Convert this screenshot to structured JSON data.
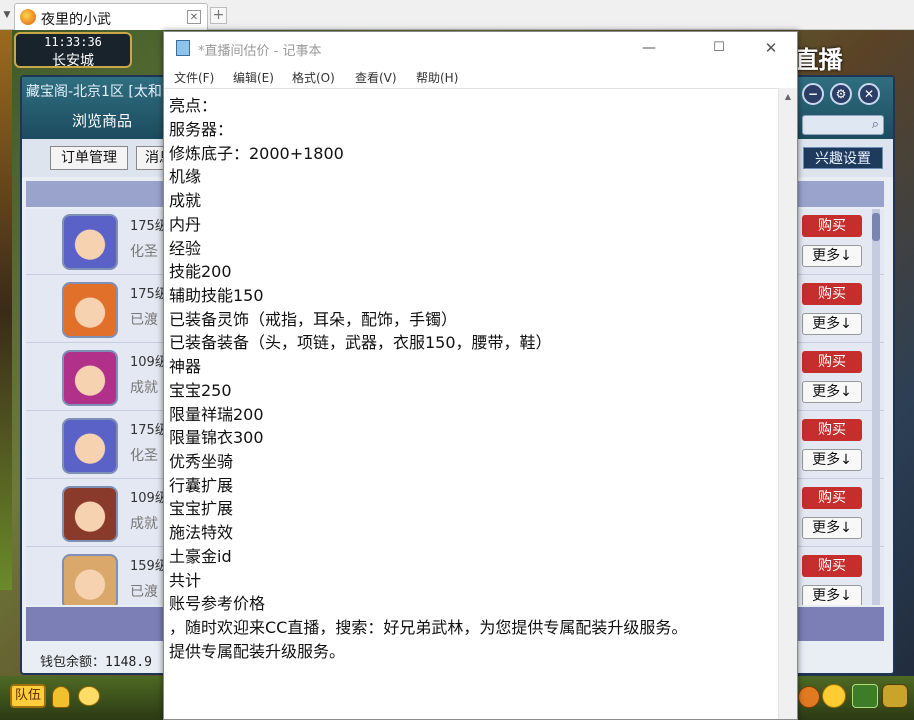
{
  "browser": {
    "tab_title": "夜里的小武",
    "close_glyph": "✕",
    "new_tab_glyph": "+",
    "tab_scroll_glyph": "▼"
  },
  "game": {
    "clock": "11:33:36",
    "city": "长安城",
    "watermark": "CC直播"
  },
  "shop": {
    "title": "藏宝阁-北京1区 [太和",
    "nav_label": "浏览商品",
    "minimize_glyph": "−",
    "settings_glyph": "⚙",
    "close_glyph": "✕",
    "search_glyph": "⌕",
    "order_button": "订单管理",
    "message_button": "消息",
    "interest_button": "兴趣设置",
    "rows": [
      {
        "level": "175级",
        "sub": "化圣",
        "buy": "购买",
        "more": "更多↓",
        "color": "#5a62c8"
      },
      {
        "level": "175级",
        "sub": "已渡",
        "buy": "购买",
        "more": "更多↓",
        "color": "#e0702a"
      },
      {
        "level": "109级",
        "sub": "成就",
        "buy": "购买",
        "more": "更多↓",
        "color": "#b0308a"
      },
      {
        "level": "175级",
        "sub": "化圣",
        "buy": "购买",
        "more": "更多↓",
        "color": "#5a62c8"
      },
      {
        "level": "109级",
        "sub": "成就",
        "buy": "购买",
        "more": "更多↓",
        "color": "#8a3a2a"
      },
      {
        "level": "159级",
        "sub": "已渡",
        "buy": "购买",
        "more": "更多↓",
        "color": "#d9a86a"
      }
    ],
    "wallet": "钱包余额：1148.9"
  },
  "bottom_bar": {
    "team_button": "队伍"
  },
  "notepad": {
    "title": "*直播间估价 - 记事本",
    "minimize_glyph": "—",
    "maximize_glyph": "☐",
    "close_glyph": "✕",
    "scroll_up_glyph": "▲",
    "menu": [
      "文件(F)",
      "编辑(E)",
      "格式(O)",
      "查看(V)",
      "帮助(H)"
    ],
    "lines": [
      "亮点：",
      "服务器：",
      "修炼底子：2000+1800",
      "机缘",
      "成就",
      "内丹",
      "经验",
      "技能200",
      "辅助技能150",
      "已装备灵饰（戒指，耳朵，配饰，手镯）",
      "已装备装备（头，项链，武器，衣服150，腰带，鞋）",
      "神器",
      "宝宝250",
      "限量祥瑞200",
      "限量锦衣300",
      "优秀坐骑",
      "行囊扩展",
      "宝宝扩展",
      "施法特效",
      "土豪金id",
      "共计",
      "账号参考价格",
      "，随时欢迎来CC直播，搜索：好兄弟武林，为您提供专属配装升级服务。",
      "提供专属配装升级服务。"
    ]
  }
}
